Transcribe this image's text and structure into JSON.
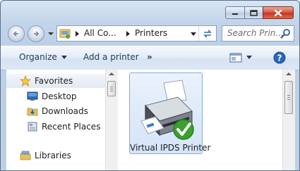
{
  "window": {
    "controls": [
      "minimize-icon",
      "maximize-icon",
      "close-icon"
    ]
  },
  "address_bar": {
    "segments": [
      "All Co...",
      "Printers"
    ]
  },
  "search": {
    "placeholder": "Search Prin..."
  },
  "toolbar": {
    "organize_label": "Organize",
    "add_printer_label": "Add a printer",
    "more_label": "»"
  },
  "nav_pane": {
    "items": [
      {
        "label": "Favorites",
        "icon": "star-icon"
      },
      {
        "label": "Desktop",
        "icon": "desktop-icon"
      },
      {
        "label": "Downloads",
        "icon": "downloads-folder-icon"
      },
      {
        "label": "Recent Places",
        "icon": "recent-places-icon"
      },
      {
        "label": "Libraries",
        "icon": "libraries-icon"
      }
    ]
  },
  "content": {
    "items": [
      {
        "label": "Virtual IPDS Printer",
        "icon": "printer-icon",
        "default": true
      }
    ]
  },
  "colors": {
    "accent": "#3a7bd5",
    "default_check": "#3aa12d",
    "close_button": "#c0351f"
  }
}
